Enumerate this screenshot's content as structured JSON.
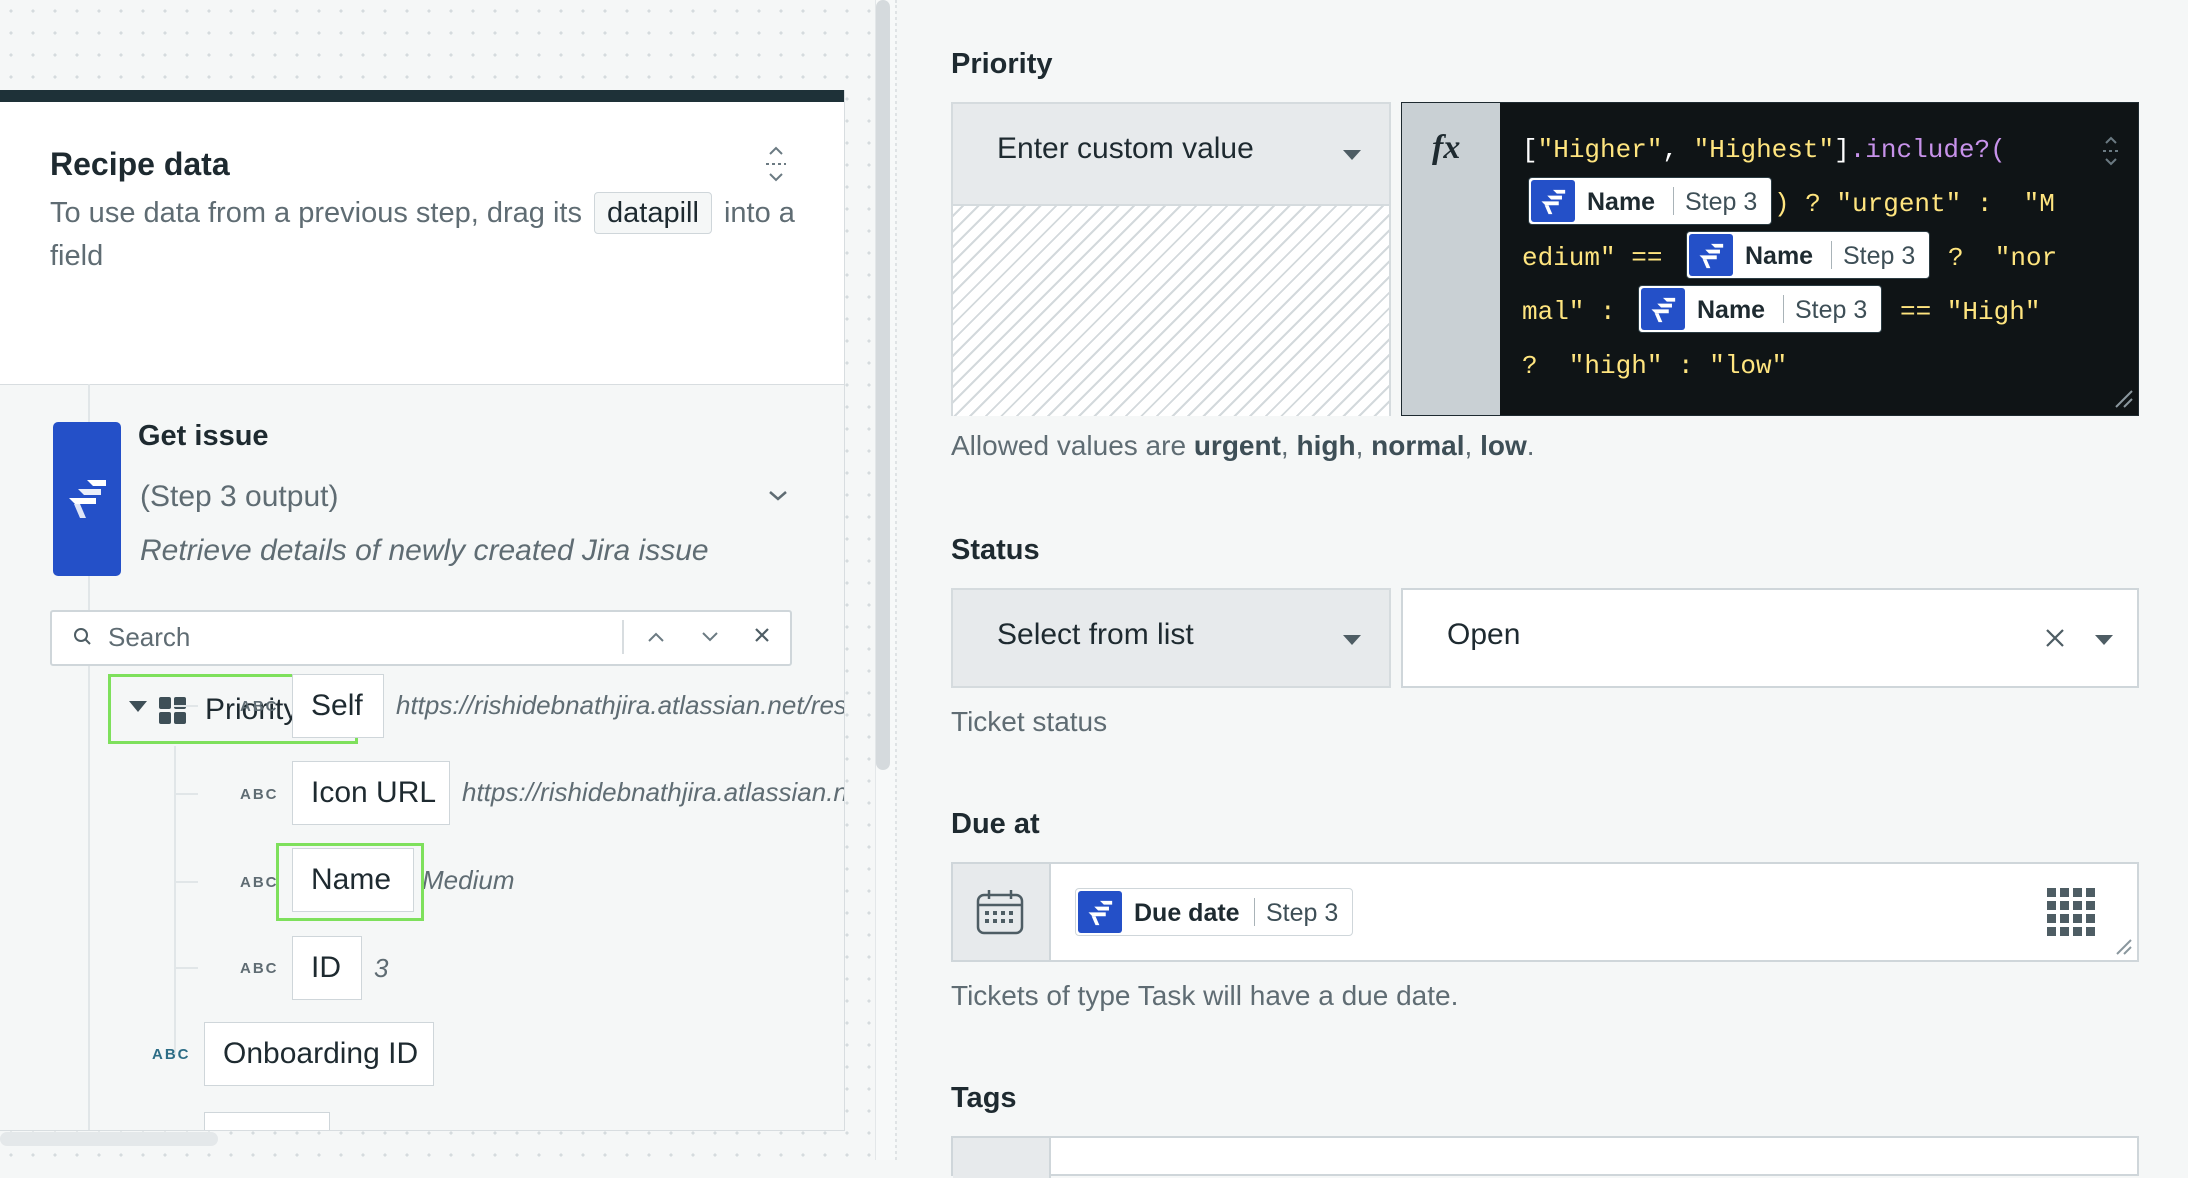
{
  "recipe_panel": {
    "title": "Recipe data",
    "desc_before": "To use data from a previous step, drag its",
    "desc_chip": "datapill",
    "desc_after": "into a field",
    "step": {
      "title": "Get issue",
      "subtitle": "(Step 3 output)",
      "description": "Retrieve details of newly created Jira issue"
    },
    "search": {
      "placeholder": "Search"
    },
    "tree": {
      "priority_label": "Priority",
      "type_abbr": "ABC",
      "children": [
        {
          "label": "Self",
          "value": "https://rishidebnathjira.atlassian.net/res"
        },
        {
          "label": "Icon URL",
          "value": "https://rishidebnathjira.atlassian.n"
        },
        {
          "label": "Name",
          "value": "Medium"
        },
        {
          "label": "ID",
          "value": "3"
        }
      ],
      "sibling": {
        "label": "Onboarding ID"
      }
    }
  },
  "form": {
    "priority": {
      "label": "Priority",
      "mode": "Enter custom value",
      "fx": "fx",
      "formula": {
        "l1_open": "[",
        "l1_s1": "\"Higher\"",
        "l1_comma": ", ",
        "l1_s2": "\"Highest\"",
        "l1_close": "]",
        "l1_method": ".include?(",
        "l2_rest": ") ? \"urgent\" :  \"M",
        "l3_start": "edium\" ==",
        "l3_rest": "?  \"nor",
        "l4_start": "mal\" :",
        "l4_rest": "== \"High\"",
        "l5": "?  \"high\" : \"low\""
      },
      "pill_name": "Name",
      "pill_step": "Step 3",
      "hint_prefix": "Allowed values are ",
      "allowed": [
        "urgent",
        "high",
        "normal",
        "low"
      ],
      "sep": ", ",
      "end": "."
    },
    "status": {
      "label": "Status",
      "mode": "Select from list",
      "value": "Open",
      "clear": "×",
      "hint": "Ticket status"
    },
    "due": {
      "label": "Due at",
      "pill_name": "Due date",
      "pill_step": "Step 3",
      "hint": "Tickets of type Task will have a due date."
    },
    "tags": {
      "label": "Tags"
    }
  },
  "colors": {
    "brand": "#2450c8",
    "highlight": "#7ee05c",
    "formula_bg": "#0f1416",
    "formula_string": "#ffe57f",
    "formula_method": "#c792ea"
  },
  "icons": [
    "jira-logo-icon",
    "search-icon",
    "chevron-up-icon",
    "chevron-down-icon",
    "close-icon",
    "expand-collapse-icon",
    "object-grid-icon",
    "calendar-icon",
    "grid-dots-icon",
    "resize-handle-icon",
    "dropdown-caret-icon"
  ]
}
